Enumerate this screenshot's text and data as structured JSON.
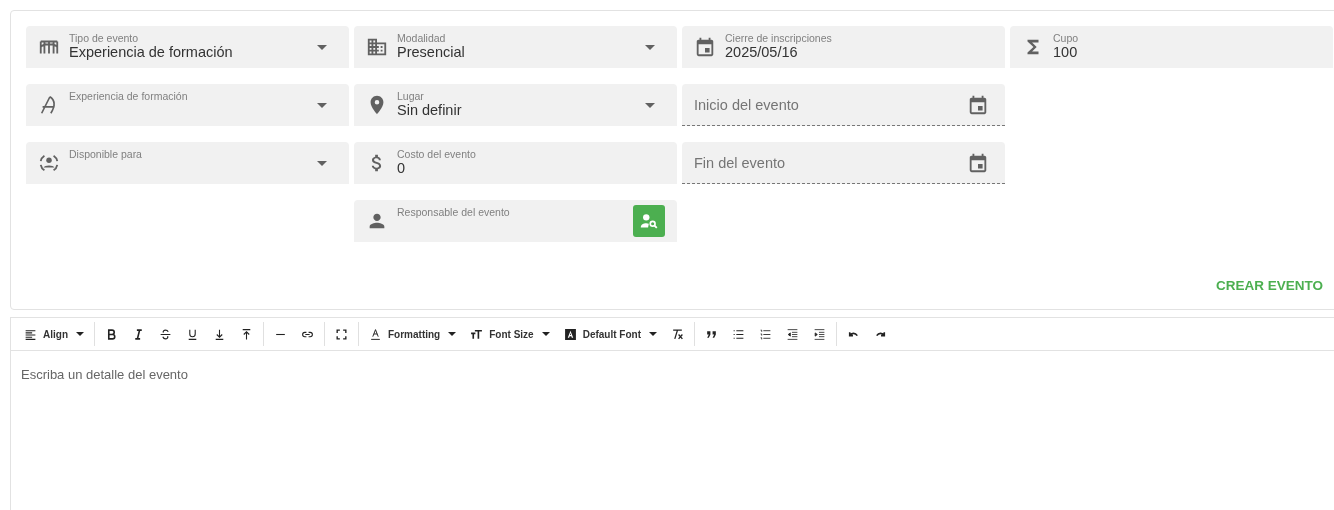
{
  "form": {
    "columns": [
      [
        {
          "kind": "select",
          "label": "Tipo de evento",
          "value": "Experiencia de formación"
        },
        {
          "kind": "select",
          "label": "Experiencia de formación"
        },
        {
          "kind": "select",
          "label": "Disponible para"
        }
      ],
      [
        {
          "kind": "select",
          "label": "Modalidad",
          "value": "Presencial"
        },
        {
          "kind": "select",
          "label": "Lugar",
          "value": "Sin definir"
        },
        {
          "kind": "input",
          "label": "Costo del evento",
          "value": "0"
        },
        {
          "kind": "lookup",
          "label": "Responsable del evento"
        }
      ],
      [
        {
          "kind": "input",
          "label": "Cierre de inscripciones",
          "value": "2025/05/16"
        },
        {
          "kind": "date",
          "placeholder": "Inicio del evento"
        },
        {
          "kind": "date",
          "placeholder": "Fin del evento"
        }
      ],
      [
        {
          "kind": "input",
          "label": "Cupo",
          "value": "100"
        }
      ]
    ],
    "submit": "CREAR EVENTO"
  },
  "editor": {
    "dropdowns": [
      {
        "label": "Align"
      },
      {
        "label": "Formatting"
      },
      {
        "label": "Font Size"
      },
      {
        "label": "Default Font"
      }
    ],
    "placeholder": "Escriba un detalle del evento"
  }
}
